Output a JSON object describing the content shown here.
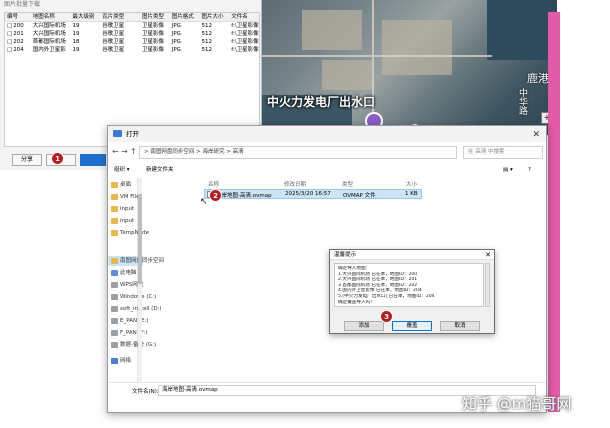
{
  "background_app": {
    "title": "图片批量下载",
    "columns": [
      "编号",
      "地图名称",
      "最大级别",
      "瓦片类型",
      "图片类型",
      "图片格式",
      "图片大小",
      "文件名"
    ],
    "rows": [
      [
        "200",
        "大兴国际机场",
        "19",
        "谷歌卫星",
        "卫星影像",
        "JPG",
        "512",
        "f:\\卫星影像\\"
      ],
      [
        "201",
        "大兴国际机场",
        "19",
        "谷歌卫星",
        "卫星影像",
        "JPG",
        "512",
        "f:\\卫星影像\\"
      ],
      [
        "202",
        "首都国际机场",
        "18",
        "谷歌卫星",
        "卫星影像",
        "JPG",
        "512",
        "f:\\卫星影像\\"
      ],
      [
        "204",
        "国内外卫星影",
        "19",
        "谷歌卫星",
        "卫星影像",
        "JPG",
        "512",
        "f:\\卫星影像\\"
      ]
    ],
    "footer_button": "分享"
  },
  "map": {
    "title": "中火力发电厂出水口",
    "city": "鹿港",
    "road": "中华路"
  },
  "dialog": {
    "title": "打开",
    "address": "> 南图网盘同步空间 > 海岸研究 > 高清",
    "search_placeholder": "在 高清 中搜索",
    "toolbar_organize": "组织 ▾",
    "toolbar_new_folder": "新建文件夹",
    "columns": {
      "name": "名称",
      "date": "修改日期",
      "type": "类型",
      "size": "大小"
    },
    "sidebar": [
      {
        "label": "桌面",
        "kind": "folder"
      },
      {
        "label": "VM Files",
        "kind": "folder"
      },
      {
        "label": "input",
        "kind": "folder"
      },
      {
        "label": "input",
        "kind": "folder"
      },
      {
        "label": "TempNode",
        "kind": "folder"
      },
      {
        "label": "南图网盘同步空间",
        "kind": "sel"
      },
      {
        "label": "此电脑",
        "kind": "pc"
      },
      {
        "label": "WPS网盘",
        "kind": "drive"
      },
      {
        "label": "Windows (C:)",
        "kind": "drive"
      },
      {
        "label": "soft_install (D:)",
        "kind": "drive"
      },
      {
        "label": "E_PAN (E:)",
        "kind": "drive"
      },
      {
        "label": "F_PAN (F:)",
        "kind": "drive"
      },
      {
        "label": "数据-备份 (G:)",
        "kind": "drive"
      },
      {
        "label": "网络",
        "kind": "net"
      }
    ],
    "file": {
      "name": "海岸地图-高清.ovmap",
      "date": "2025/3/20 16:57",
      "type": "OVMAP 文件",
      "size": "1 KB"
    },
    "filename_label": "文件名(N):",
    "filename_value": "海岸地图-高清.ovmap"
  },
  "prompt": {
    "title": "温馨提示",
    "lines": [
      "确定导入地图：",
      "1.大兴国际机场 已在本，地图ID：200",
      "2.大兴国际机场 已在本，地图ID：201",
      "3.首都国际机场 已在本，地图ID：202",
      "4.国内外卫星影像 已在本，地图ID：204",
      "5.[中火力发电厂出水口] 已在本，地图ID：204",
      "",
      "确定覆盖导入吗？"
    ],
    "buttons": {
      "add": "添加",
      "overwrite": "覆盖",
      "cancel": "取消"
    }
  },
  "steps": [
    "1",
    "2",
    "3"
  ],
  "watermark": "知乎 @m猫哥网"
}
